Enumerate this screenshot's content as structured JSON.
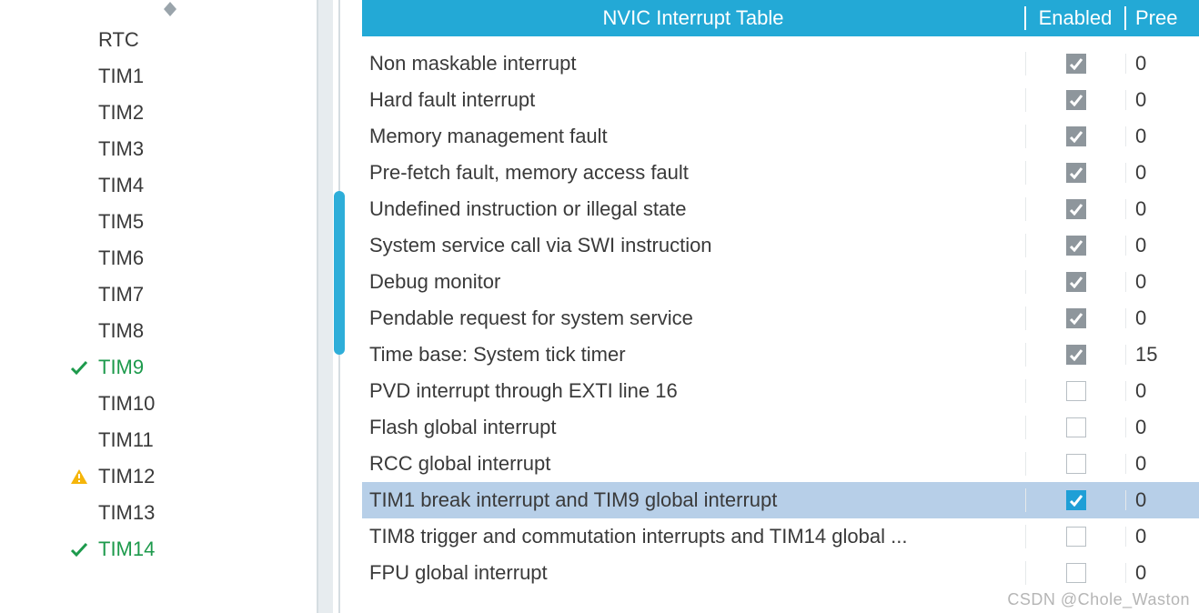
{
  "sidebar": {
    "items": [
      {
        "label": "RTC",
        "status": "none"
      },
      {
        "label": "TIM1",
        "status": "none"
      },
      {
        "label": "TIM2",
        "status": "none"
      },
      {
        "label": "TIM3",
        "status": "none"
      },
      {
        "label": "TIM4",
        "status": "none"
      },
      {
        "label": "TIM5",
        "status": "none"
      },
      {
        "label": "TIM6",
        "status": "none"
      },
      {
        "label": "TIM7",
        "status": "none"
      },
      {
        "label": "TIM8",
        "status": "none"
      },
      {
        "label": "TIM9",
        "status": "enabled"
      },
      {
        "label": "TIM10",
        "status": "none"
      },
      {
        "label": "TIM11",
        "status": "none"
      },
      {
        "label": "TIM12",
        "status": "warning"
      },
      {
        "label": "TIM13",
        "status": "none"
      },
      {
        "label": "TIM14",
        "status": "enabled"
      }
    ]
  },
  "table": {
    "headers": {
      "name": "NVIC Interrupt Table",
      "enabled": "Enabled",
      "preemption": "Pree"
    },
    "rows": [
      {
        "name": "Non maskable interrupt",
        "enabled": true,
        "locked": true,
        "priority": "0",
        "selected": false
      },
      {
        "name": "Hard fault interrupt",
        "enabled": true,
        "locked": true,
        "priority": "0",
        "selected": false
      },
      {
        "name": "Memory management fault",
        "enabled": true,
        "locked": true,
        "priority": "0",
        "selected": false
      },
      {
        "name": "Pre-fetch fault, memory access fault",
        "enabled": true,
        "locked": true,
        "priority": "0",
        "selected": false
      },
      {
        "name": "Undefined instruction or illegal state",
        "enabled": true,
        "locked": true,
        "priority": "0",
        "selected": false
      },
      {
        "name": "System service call via SWI instruction",
        "enabled": true,
        "locked": true,
        "priority": "0",
        "selected": false
      },
      {
        "name": "Debug monitor",
        "enabled": true,
        "locked": true,
        "priority": "0",
        "selected": false
      },
      {
        "name": "Pendable request for system service",
        "enabled": true,
        "locked": true,
        "priority": "0",
        "selected": false
      },
      {
        "name": "Time base: System tick timer",
        "enabled": true,
        "locked": true,
        "priority": "15",
        "selected": false
      },
      {
        "name": "PVD interrupt through EXTI line 16",
        "enabled": false,
        "locked": false,
        "priority": "0",
        "selected": false
      },
      {
        "name": "Flash global interrupt",
        "enabled": false,
        "locked": false,
        "priority": "0",
        "selected": false
      },
      {
        "name": "RCC global interrupt",
        "enabled": false,
        "locked": false,
        "priority": "0",
        "selected": false
      },
      {
        "name": "TIM1 break interrupt and TIM9 global interrupt",
        "enabled": true,
        "locked": false,
        "priority": "0",
        "selected": true
      },
      {
        "name": "TIM8 trigger and commutation interrupts and TIM14 global ...",
        "enabled": false,
        "locked": false,
        "priority": "0",
        "selected": false
      },
      {
        "name": "FPU global interrupt",
        "enabled": false,
        "locked": false,
        "priority": "0",
        "selected": false
      }
    ]
  },
  "watermark": "CSDN @Chole_Waston"
}
